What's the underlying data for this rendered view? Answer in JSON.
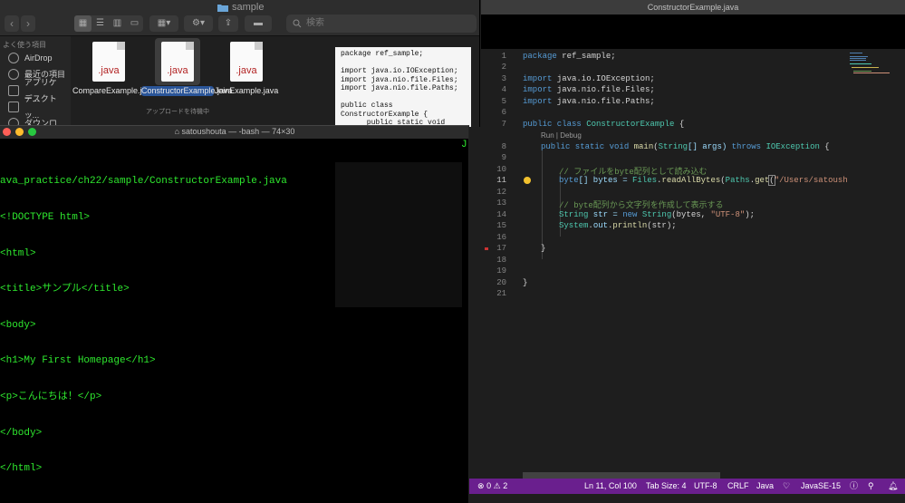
{
  "finder": {
    "title": "sample",
    "search_placeholder": "検索",
    "sidebar_heading": "よく使う項目",
    "sidebar_items": [
      "AirDrop",
      "最近の項目",
      "アプリケー...",
      "デスクトッ...",
      "ダウンロ..."
    ],
    "files": [
      {
        "ext": ".java",
        "name": "CompareExample.java",
        "sub": ""
      },
      {
        "ext": ".java",
        "name": "ConstructorExample.java",
        "sub": "アップロードを待機中"
      },
      {
        "ext": ".java",
        "name": "JoinExample.java",
        "sub": ""
      }
    ],
    "preview_text": "package ref_sample;\n\nimport java.io.IOException;\nimport java.nio.file.Files;\nimport java.nio.file.Paths;\n\npublic class\nConstructorExample {\n      public static void"
  },
  "terminal": {
    "title": "satoushouta — -bash — 74×30",
    "lines": [
      "ava_practice/ch22/sample/ConstructorExample.java",
      "<!DOCTYPE html>",
      "<html>",
      "<title>サンプル</title>",
      "<body>",
      "<h1>My First Homepage</h1>",
      "<p>こんにちは！</p>",
      "</body>",
      "</html>"
    ],
    "right_edge_char": "J"
  },
  "editor": {
    "title": "ConstructorExample.java",
    "line_numbers": [
      "1",
      "2",
      "3",
      "4",
      "5",
      "6",
      "7",
      "8",
      "9",
      "10",
      "11",
      "12",
      "13",
      "14",
      "15",
      "16",
      "17",
      "18",
      "19",
      "20",
      "21"
    ],
    "active_line": 11,
    "codelens": "Run | Debug",
    "code": {
      "l1a": "package",
      "l1b": " ref_sample;",
      "l3a": "import",
      "l3b": " java.io.IOException;",
      "l4a": "import",
      "l4b": " java.nio.file.Files;",
      "l5a": "import",
      "l5b": " java.nio.file.Paths;",
      "l7a": "public class",
      "l7b": " ConstructorExample",
      "l7c": " {",
      "l8a": "public static void",
      "l8b": " main",
      "l8c": "(",
      "l8d": "String",
      "l8e": "[] args) ",
      "l8f": "throws",
      "l8g": " IOException",
      "l8h": " {",
      "l10": "// ファイルをbyte配列として読み込む",
      "l11a": "byte",
      "l11b": "[] bytes = ",
      "l11c": "Files",
      "l11d": ".",
      "l11e": "readAllBytes",
      "l11f": "(",
      "l11g": "Paths",
      "l11h": ".",
      "l11i": "get",
      "l11j": "(",
      "l11k": "\"/Users/satoushouta",
      "l13": "// byte配列から文字列を作成して表示する",
      "l14a": "String",
      "l14b": " str = ",
      "l14c": "new",
      "l14d": " String",
      "l14e": "(bytes, ",
      "l14f": "\"UTF-8\"",
      "l14g": ");",
      "l15a": "System",
      "l15b": ".",
      "l15c": "out",
      "l15d": ".",
      "l15e": "println",
      "l15f": "(str);",
      "l17": "}",
      "l20": "}"
    }
  },
  "statusbar": {
    "errors": "0",
    "warnings": "2",
    "position": "Ln 11, Col 100",
    "tab_size": "Tab Size: 4",
    "encoding": "UTF-8",
    "eol": "CRLF",
    "language": "Java",
    "jdk": "JavaSE-15"
  },
  "colors": {
    "statusbar": "#6a1f8e",
    "terminal_text": "#2ee82e",
    "keyword": "#569cd6",
    "type": "#4ec9b0",
    "string": "#ce9178",
    "comment": "#6a9955"
  }
}
